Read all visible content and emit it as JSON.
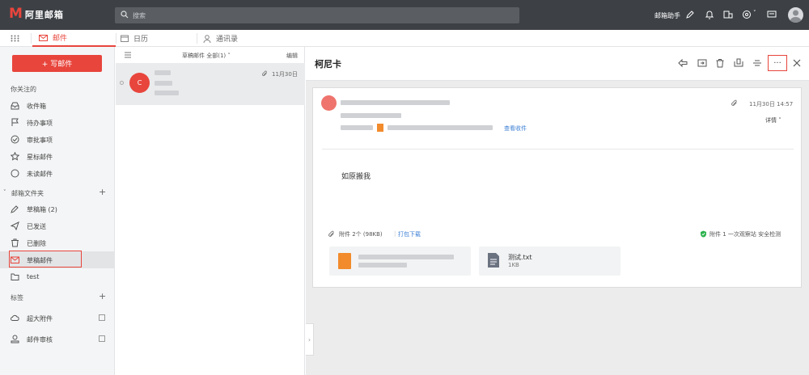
{
  "app": {
    "logo_mark": "M",
    "logo_text": "阿里邮箱"
  },
  "topbar": {
    "search_placeholder": "搜索",
    "helper_label": "邮箱助手"
  },
  "tabs": [
    {
      "label": "邮件"
    },
    {
      "label": "日历"
    },
    {
      "label": "通讯录"
    }
  ],
  "sidebar": {
    "write_label": "+ 写邮件",
    "section_focus": "你关注的",
    "focus_items": [
      {
        "label": "收件箱",
        "icon": "inbox-icon"
      },
      {
        "label": "待办事项",
        "icon": "flag-icon"
      },
      {
        "label": "审批事项",
        "icon": "approval-icon"
      },
      {
        "label": "星标邮件",
        "icon": "star-icon"
      },
      {
        "label": "未读邮件",
        "icon": "unread-icon"
      }
    ],
    "section_folders": "邮箱文件夹",
    "folder_items": [
      {
        "label": "草稿箱 (2)",
        "icon": "draft-icon"
      },
      {
        "label": "已发送",
        "icon": "sent-icon"
      },
      {
        "label": "已删除",
        "icon": "trash-icon"
      },
      {
        "label": "草稿邮件",
        "icon": "mail-icon"
      },
      {
        "label": "test",
        "icon": "folder-icon"
      }
    ],
    "section_tags": "标签",
    "extra_items": [
      {
        "label": "超大附件",
        "icon": "cloud-icon"
      },
      {
        "label": "邮件审核",
        "icon": "review-icon"
      }
    ]
  },
  "maillist": {
    "header_center": "草稿邮件 全部(1) ˅",
    "header_right": "编辑",
    "items": [
      {
        "avatar_letter": "C",
        "date": "11月30日"
      }
    ]
  },
  "reader": {
    "subject": "柯尼卡",
    "timestamp": "11月30日 14:57",
    "detail_label": "详情 ˅",
    "view_receipt": "查看收件",
    "body_text": "如原搬我",
    "attachments_label": "附件 2个 (98KB)",
    "download_all": "打包下载",
    "security_note": "附件 1 一次观察站 安全检测",
    "attachments": [
      {
        "name": "",
        "size": ""
      },
      {
        "name": "测试.txt",
        "size": "1KB"
      }
    ],
    "more_label": "···"
  },
  "colors": {
    "accent": "#e8453c",
    "topbar": "#3d4146",
    "link": "#3c7fd4"
  }
}
